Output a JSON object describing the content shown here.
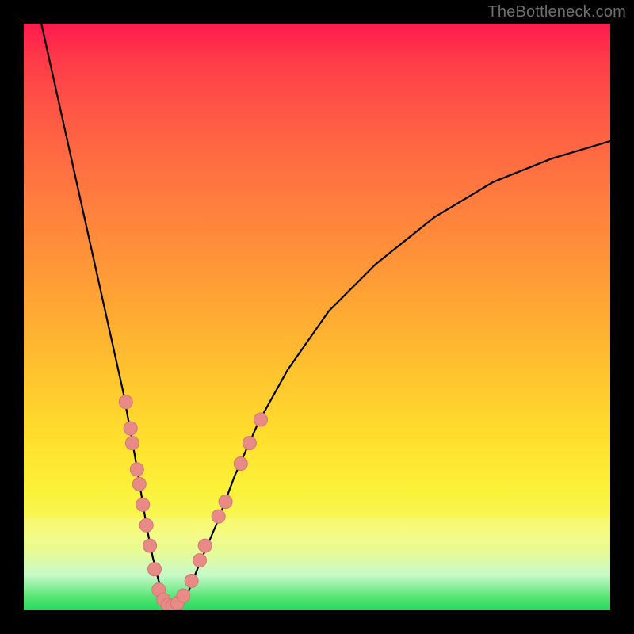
{
  "watermark": "TheBottleneck.com",
  "colors": {
    "curve": "#000000",
    "dot_fill": "#e88a86",
    "dot_stroke": "#d17873",
    "background_frame": "#000000"
  },
  "chart_data": {
    "type": "line",
    "title": "",
    "xlabel": "",
    "ylabel": "",
    "xlim": [
      0,
      100
    ],
    "ylim": [
      0,
      100
    ],
    "grid": false,
    "legend": false,
    "background": "red-yellow-green vertical gradient (bottleneck heatmap)",
    "series": [
      {
        "name": "bottleneck-curve",
        "x": [
          3,
          5,
          7,
          9,
          11,
          13,
          15,
          17,
          19,
          20,
          21,
          22,
          23,
          24,
          25,
          26,
          28,
          30,
          33,
          36,
          40,
          45,
          52,
          60,
          70,
          80,
          90,
          100
        ],
        "y": [
          100,
          91,
          82,
          73,
          64,
          55,
          46,
          37,
          26,
          20,
          14,
          9,
          5,
          2,
          1,
          1,
          3,
          8,
          15,
          23,
          32,
          41,
          51,
          59,
          67,
          73,
          77,
          80
        ]
      }
    ],
    "marker_clusters": [
      {
        "name": "left-branch-dots",
        "points": [
          {
            "x": 17.4,
            "y": 35.5
          },
          {
            "x": 18.2,
            "y": 31.0
          },
          {
            "x": 18.5,
            "y": 28.5
          },
          {
            "x": 19.3,
            "y": 24.0
          },
          {
            "x": 19.7,
            "y": 21.5
          },
          {
            "x": 20.3,
            "y": 18.0
          },
          {
            "x": 20.9,
            "y": 14.5
          },
          {
            "x": 21.5,
            "y": 11.0
          },
          {
            "x": 22.3,
            "y": 7.0
          }
        ]
      },
      {
        "name": "valley-dots",
        "points": [
          {
            "x": 23.0,
            "y": 3.5
          },
          {
            "x": 23.8,
            "y": 1.8
          },
          {
            "x": 24.6,
            "y": 0.9
          },
          {
            "x": 25.4,
            "y": 0.8
          },
          {
            "x": 26.2,
            "y": 1.2
          },
          {
            "x": 27.2,
            "y": 2.5
          }
        ]
      },
      {
        "name": "right-branch-dots",
        "points": [
          {
            "x": 28.6,
            "y": 5.0
          },
          {
            "x": 30.0,
            "y": 8.5
          },
          {
            "x": 30.9,
            "y": 11.0
          },
          {
            "x": 33.2,
            "y": 16.0
          },
          {
            "x": 34.4,
            "y": 18.5
          },
          {
            "x": 37.0,
            "y": 25.0
          },
          {
            "x": 38.5,
            "y": 28.5
          },
          {
            "x": 40.4,
            "y": 32.5
          }
        ]
      }
    ]
  }
}
